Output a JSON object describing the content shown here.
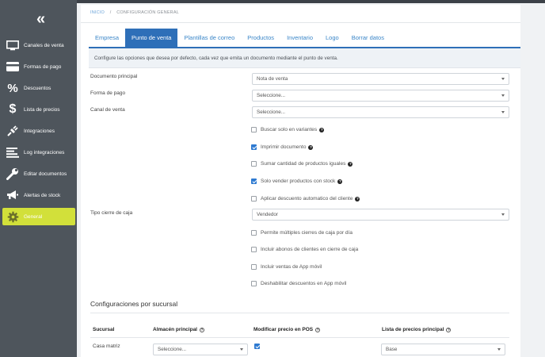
{
  "breadcrumb": {
    "home": "INICIO",
    "separator": "/",
    "current": "CONFIGURACIÓN GENERAL"
  },
  "sidebar": {
    "collapse_label": "«",
    "items": [
      {
        "label": "Canales de venta",
        "icon": "monitor-icon"
      },
      {
        "label": "Formas de pago",
        "icon": "credit-card-icon"
      },
      {
        "label": "Descuentos",
        "icon": "percent-icon"
      },
      {
        "label": "Lista de precios",
        "icon": "dollar-icon"
      },
      {
        "label": "Integraciones",
        "icon": "plug-icon"
      },
      {
        "label": "Log integraciones",
        "icon": "list-icon"
      },
      {
        "label": "Editar documentos",
        "icon": "wrench-icon"
      },
      {
        "label": "Alertas de stock",
        "icon": "megaphone-icon"
      },
      {
        "label": "General",
        "icon": "gear-icon",
        "active": true
      }
    ]
  },
  "tabs": [
    "Empresa",
    "Punto de venta",
    "Plantillas de correo",
    "Productos",
    "Inventario",
    "Logo",
    "Borrar datos"
  ],
  "active_tab": "Punto de venta",
  "info_text": "Configure las opciones que desea por defecto, cada vez que emita un documento mediante el punto de venta.",
  "form": {
    "documento_principal": {
      "label": "Documento principal",
      "value": "Nota de venta"
    },
    "forma_pago": {
      "label": "Forma de pago",
      "value": "Seleccione..."
    },
    "canal_venta": {
      "label": "Canal de venta",
      "value": "Seleccione..."
    },
    "checks_a": [
      {
        "label": "Buscar solo en variantes",
        "checked": false
      },
      {
        "label": "Imprimir documento",
        "checked": true
      },
      {
        "label": "Sumar cantidad de productos iguales",
        "checked": false
      },
      {
        "label": "Solo vender productos con stock",
        "checked": true
      },
      {
        "label": "Aplicar descuento automatico del cliente",
        "checked": false
      }
    ],
    "tipo_cierre": {
      "label": "Tipo cierre de caja",
      "value": "Vendedor"
    },
    "checks_b": [
      {
        "label": "Permite múltiples cierres de caja por día",
        "checked": false
      },
      {
        "label": "Incluir abonos de clientes en cierre de caja",
        "checked": false
      },
      {
        "label": "Incluir ventas de App móvil",
        "checked": false
      },
      {
        "label": "Deshabilitar descuentos en App móvil",
        "checked": false
      }
    ]
  },
  "branch_section": {
    "title": "Configuraciones por sucursal",
    "headers": [
      "Sucursal",
      "Almacén principal",
      "Modificar precio en POS",
      "Lista de precios principal"
    ],
    "rows": [
      {
        "sucursal": "Casa matriz",
        "almacen": "Seleccione...",
        "modificar_precio": true,
        "lista_precios": "Base"
      }
    ]
  },
  "colors": {
    "sidebar": "#4e555c",
    "accent": "#2e6fb8",
    "active_nav": "#d2e03a"
  }
}
